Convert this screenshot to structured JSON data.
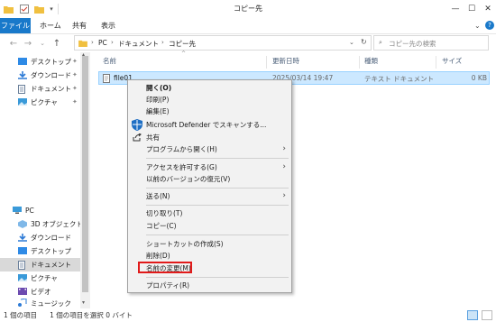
{
  "window": {
    "title": "コピー先"
  },
  "ribbon": {
    "tabs": [
      "ファイル",
      "ホーム",
      "共有",
      "表示"
    ]
  },
  "address": {
    "path": [
      "PC",
      "ドキュメント",
      "コピー先"
    ],
    "search_placeholder": "コピー先の検索"
  },
  "columns": {
    "name": "名前",
    "modified": "更新日時",
    "type": "種類",
    "size": "サイズ"
  },
  "files": [
    {
      "name": "file01",
      "modified": "2025/03/14 19:47",
      "type": "テキスト ドキュメント",
      "size": "0 KB"
    }
  ],
  "nav": {
    "quick": [
      {
        "label": "デスクトップ",
        "icon": "desktop-icon"
      },
      {
        "label": "ダウンロード",
        "icon": "download-icon"
      },
      {
        "label": "ドキュメント",
        "icon": "document-icon"
      },
      {
        "label": "ピクチャ",
        "icon": "picture-icon"
      }
    ],
    "pc_label": "PC",
    "pc": [
      {
        "label": "3D オブジェクト",
        "icon": "3d-objects-icon"
      },
      {
        "label": "ダウンロード",
        "icon": "download-icon"
      },
      {
        "label": "デスクトップ",
        "icon": "desktop-icon"
      },
      {
        "label": "ドキュメント",
        "icon": "document-icon",
        "selected": true
      },
      {
        "label": "ピクチャ",
        "icon": "picture-icon"
      },
      {
        "label": "ビデオ",
        "icon": "video-icon"
      },
      {
        "label": "ミュージック",
        "icon": "music-icon"
      }
    ]
  },
  "context_menu": {
    "open": "開く(O)",
    "print": "印刷(P)",
    "edit": "編集(E)",
    "defender": "Microsoft Defender でスキャンする...",
    "share": "共有",
    "open_with": "プログラムから開く(H)",
    "give_access": "アクセスを許可する(G)",
    "restore": "以前のバージョンの復元(V)",
    "send_to": "送る(N)",
    "cut": "切り取り(T)",
    "copy": "コピー(C)",
    "shortcut": "ショートカットの作成(S)",
    "delete": "削除(D)",
    "rename": "名前の変更(M)",
    "properties": "プロパティ(R)"
  },
  "status": {
    "count": "1 個の項目",
    "selected": "1 個の項目を選択 0 バイト"
  },
  "colors": {
    "accent": "#1979ca",
    "selection": "#cce8ff",
    "highlight": "#e11a1a"
  }
}
